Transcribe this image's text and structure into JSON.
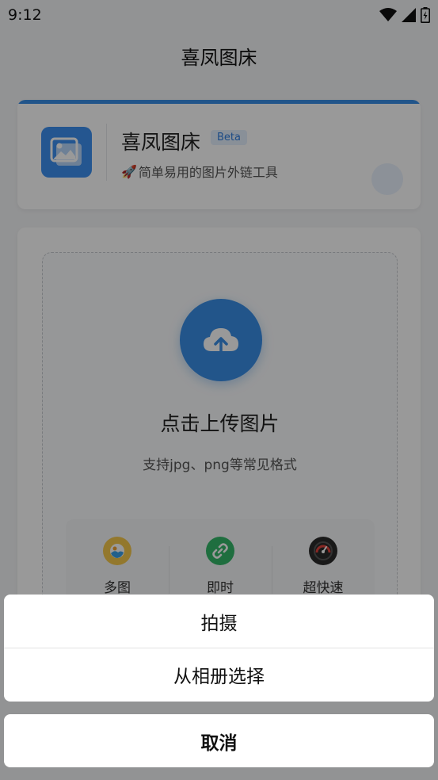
{
  "status_bar": {
    "time": "9:12"
  },
  "top_bar": {
    "title": "喜凤图床"
  },
  "header_card": {
    "app_name": "喜凤图床",
    "badge": "Beta",
    "subtitle_emoji": "🚀",
    "subtitle": "简单易用的图片外链工具"
  },
  "upload": {
    "title": "点击上传图片",
    "hint": "支持jpg、png等常见格式",
    "features": [
      {
        "label": "多图",
        "icon": "gallery-icon"
      },
      {
        "label": "即时",
        "icon": "link-icon"
      },
      {
        "label": "超快速",
        "icon": "speedometer-icon"
      }
    ]
  },
  "action_sheet": {
    "options": [
      "拍摄",
      "从相册选择"
    ],
    "cancel": "取消"
  },
  "colors": {
    "accent": "#3a8ee6",
    "badge_text": "#2f7ee0"
  }
}
